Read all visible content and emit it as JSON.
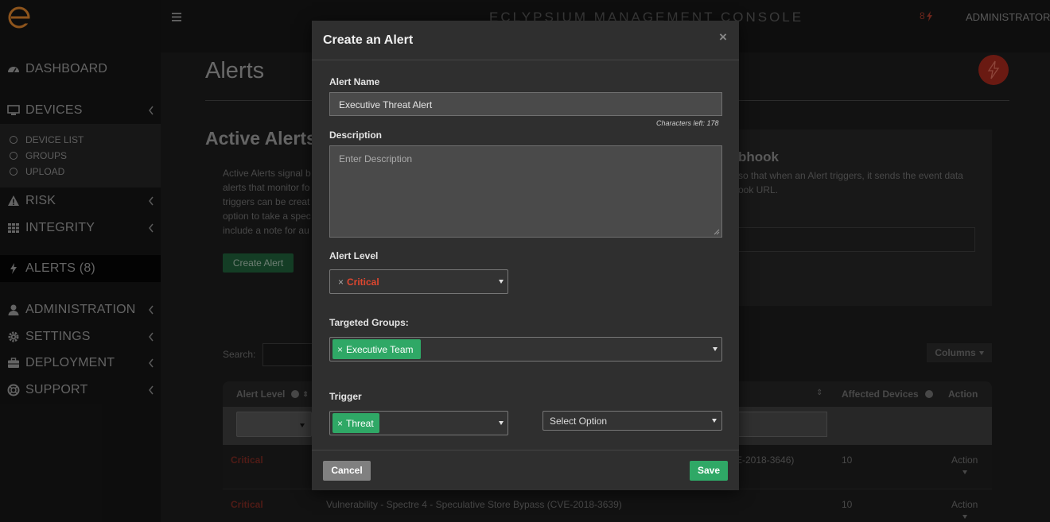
{
  "app": {
    "title": "ECLYPSIUM MANAGEMENT CONSOLE",
    "user": "ADMINISTRATOR",
    "alert_count": "8"
  },
  "sidebar": {
    "items": [
      {
        "label": "DASHBOARD",
        "icon": "dashboard-icon"
      },
      {
        "label": "DEVICES",
        "icon": "monitor-icon"
      },
      {
        "label": "RISK",
        "icon": "warning-icon"
      },
      {
        "label": "INTEGRITY",
        "icon": "grid-icon"
      },
      {
        "label": "ALERTS (8)",
        "icon": "bolt-icon"
      },
      {
        "label": "ADMINISTRATION",
        "icon": "user-icon"
      },
      {
        "label": "SETTINGS",
        "icon": "gear-icon"
      },
      {
        "label": "DEPLOYMENT",
        "icon": "briefcase-icon"
      },
      {
        "label": "SUPPORT",
        "icon": "lifebuoy-icon"
      }
    ],
    "devices_sub": [
      "DEVICE LIST",
      "GROUPS",
      "UPLOAD"
    ]
  },
  "page": {
    "title": "Alerts",
    "section_title": "Active Alerts",
    "description_lines": [
      "Active Alerts signal b",
      "alerts that monitor fo",
      "triggers can be creat",
      "option to take a spec",
      "include a note for au"
    ],
    "create_button": "Create Alert",
    "webhook_title": "bhook",
    "webhook_lines": [
      "so that when an Alert triggers, it sends the event data",
      "ook URL."
    ],
    "search_label": "Search:",
    "columns_button": "Columns"
  },
  "table": {
    "headers": {
      "alert_level": "Alert Level",
      "affected_devices": "Affected Devices",
      "action": "Action"
    },
    "rows": [
      {
        "level": "Critical",
        "name": "E-2018-3646)",
        "affected": "10",
        "action": "Action"
      },
      {
        "level": "Critical",
        "name": "Vulnerability - Spectre 4 - Speculative Store Bypass (CVE-2018-3639)",
        "affected": "10",
        "action": "Action"
      }
    ]
  },
  "modal": {
    "title": "Create an Alert",
    "close": "×",
    "alert_name_label": "Alert Name",
    "alert_name_value": "Executive Threat Alert",
    "chars_left": "Characters left: 178",
    "description_label": "Description",
    "description_placeholder": "Enter Description",
    "alert_level_label": "Alert Level",
    "alert_level_value": "Critical",
    "targeted_groups_label": "Targeted Groups:",
    "targeted_group_tag": "Executive Team",
    "trigger_label": "Trigger",
    "trigger_tag": "Threat",
    "select_option": "Select Option",
    "remove_x": "×",
    "cancel": "Cancel",
    "save": "Save"
  },
  "colors": {
    "accent_orange": "#d9822b",
    "critical_red": "#e0472f",
    "green": "#2fa866"
  }
}
